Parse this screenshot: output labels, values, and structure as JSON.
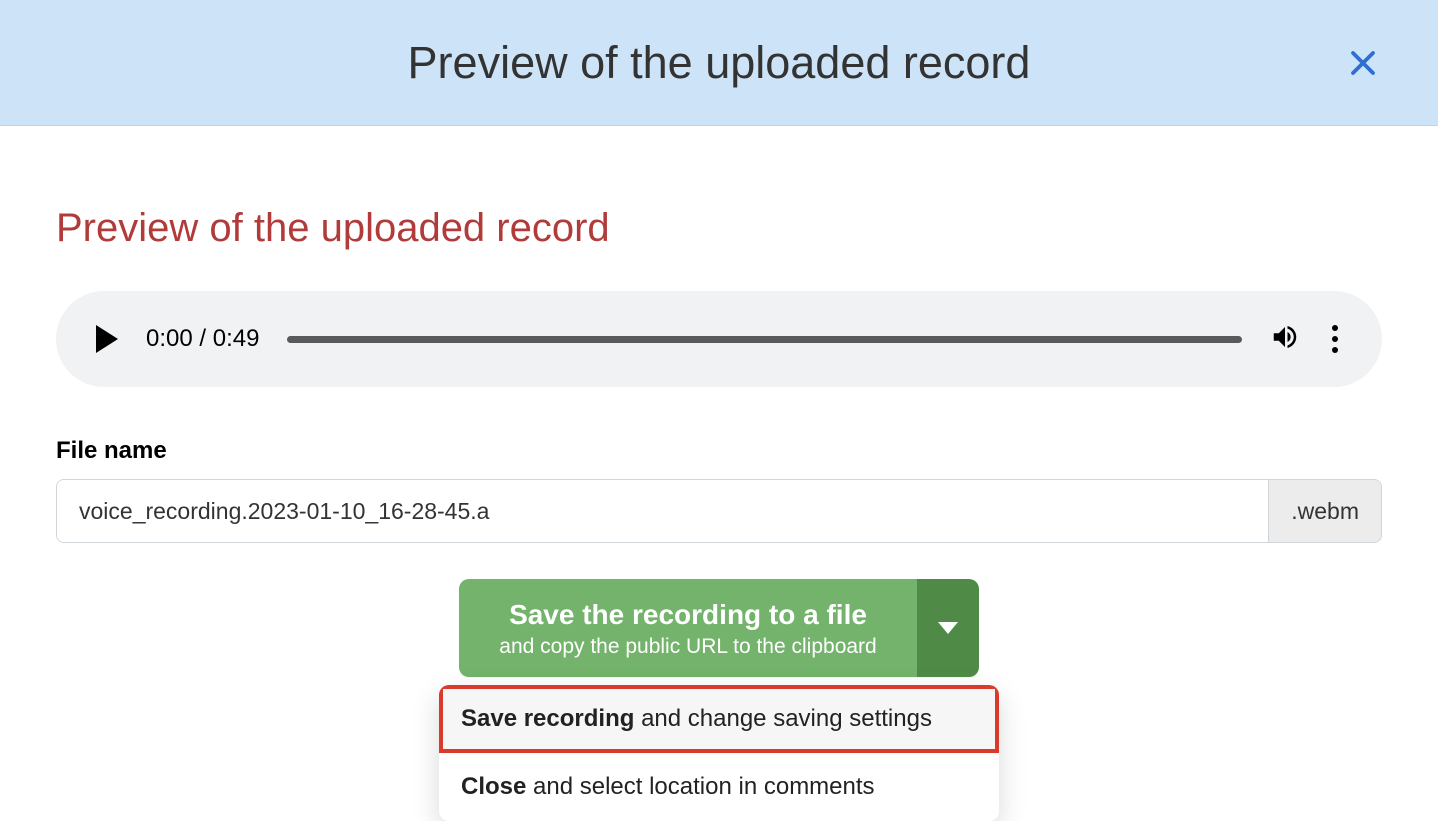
{
  "header": {
    "title": "Preview of the uploaded record"
  },
  "section": {
    "title": "Preview of the uploaded record"
  },
  "player": {
    "current_time": "0:00",
    "duration": "0:49",
    "time_display": "0:00 / 0:49"
  },
  "filename": {
    "label": "File name",
    "value": "voice_recording.2023-01-10_16-28-45.a",
    "extension": ".webm"
  },
  "save_button": {
    "primary": "Save the recording to a file",
    "secondary": "and copy the public URL to the clipboard"
  },
  "dropdown": {
    "item1_bold": "Save recording",
    "item1_rest": " and change saving settings",
    "item2_bold": "Close",
    "item2_rest": " and select location in comments"
  }
}
